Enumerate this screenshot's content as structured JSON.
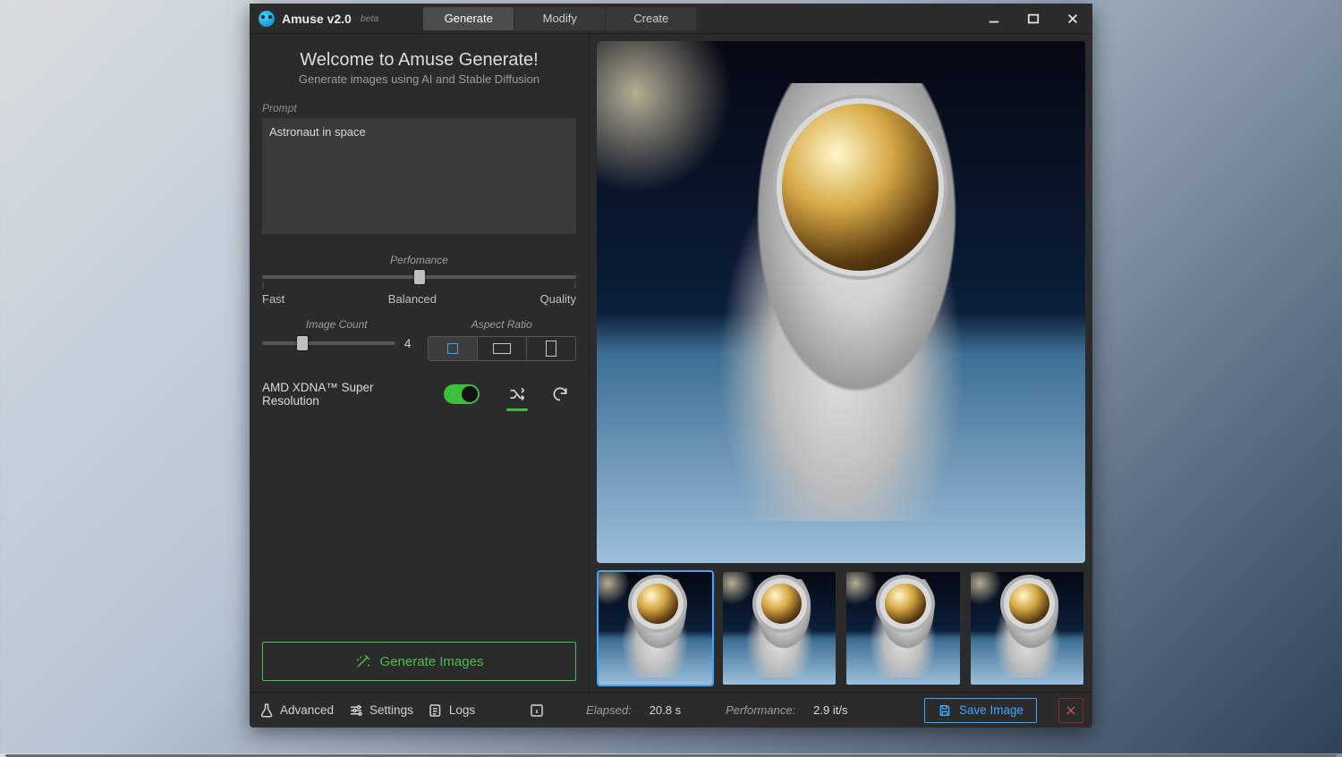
{
  "app": {
    "title": "Amuse v2.0",
    "beta_tag": "beta"
  },
  "tabs": {
    "generate": "Generate",
    "modify": "Modify",
    "create": "Create",
    "active": "generate"
  },
  "welcome": {
    "title": "Welcome to Amuse Generate!",
    "subtitle": "Generate images using AI and Stable Diffusion"
  },
  "prompt": {
    "label": "Prompt",
    "value": "Astronaut in space"
  },
  "performance": {
    "label": "Perfomance",
    "min_label": "Fast",
    "mid_label": "Balanced",
    "max_label": "Quality",
    "position_pct": 50
  },
  "image_count": {
    "label": "Image Count",
    "value": 4,
    "position_pct": 30
  },
  "aspect_ratio": {
    "label": "Aspect Ratio",
    "active": "square"
  },
  "super_resolution": {
    "label": "AMD XDNA™ Super Resolution",
    "enabled": true
  },
  "shuffle_active": true,
  "generate_button": "Generate Images",
  "bottom": {
    "advanced": "Advanced",
    "settings": "Settings",
    "logs": "Logs",
    "elapsed_label": "Elapsed:",
    "elapsed_value": "20.8 s",
    "perf_label": "Performance:",
    "perf_value": "2.9 it/s",
    "save": "Save Image"
  },
  "thumbnails": {
    "count": 4,
    "active_index": 0
  }
}
